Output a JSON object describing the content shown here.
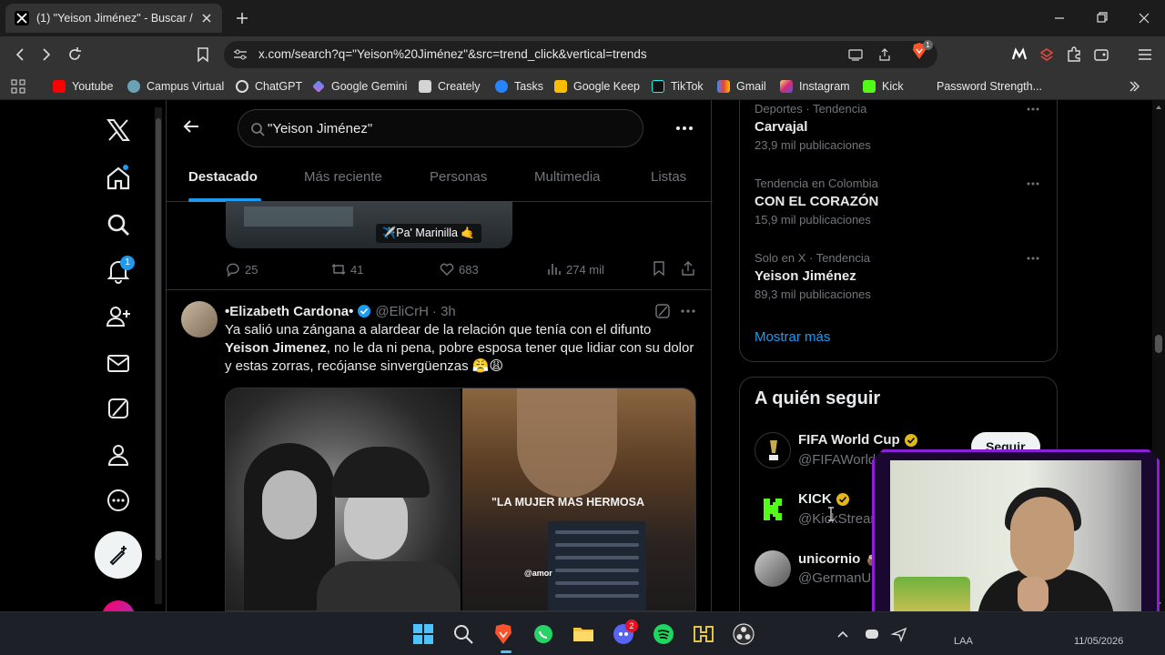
{
  "browser": {
    "tab_title": "(1) \"Yeison Jiménez\" - Buscar / X",
    "url": "x.com/search?q=\"Yeison%20Jiménez\"&src=trend_click&vertical=trends",
    "shield_count": "1",
    "bookmarks": [
      "Youtube",
      "Campus Virtual",
      "ChatGPT",
      "Google Gemini",
      "Creately",
      "Tasks",
      "Google Keep",
      "TikTok",
      "Gmail",
      "Instagram",
      "Kick",
      "Password Strength..."
    ]
  },
  "sidebar": {
    "notif_count": "1",
    "icons": [
      "x-logo-icon",
      "home-icon",
      "explore-icon",
      "notifications-icon",
      "follow-icon",
      "messages-icon",
      "grok-icon",
      "profile-icon",
      "more-icon",
      "post-icon"
    ]
  },
  "search": {
    "query": "\"Yeison Jiménez\""
  },
  "tabs": [
    "Destacado",
    "Más reciente",
    "Personas",
    "Multimedia",
    "Listas"
  ],
  "prev_tweet": {
    "media_label": "✈️Pa' Marinilla 🤙",
    "replies": "25",
    "reposts": "41",
    "likes": "683",
    "views": "274 mil"
  },
  "tweet": {
    "name": "•Elizabeth Cardona•",
    "handle": "@EliCrH",
    "time": "· 3h",
    "text_1": "Ya salió una zángana a alardear de la relación que tenía con el difunto ",
    "text_bold": "Yeison Jimenez",
    "text_2": ", no le da ni pena, pobre esposa tener que lidiar con su dolor y estas zorras, recójanse sinvergüenzas 😤😩",
    "media_caption": "\"LA MUJER MAS HERMOSA",
    "media_small": "@amor"
  },
  "trends": [
    {
      "meta": "Deportes · Tendencia",
      "name": "Carvajal",
      "count": "23,9 mil publicaciones"
    },
    {
      "meta": "Tendencia en Colombia",
      "name": "CON EL CORAZÓN",
      "count": "15,9 mil publicaciones"
    },
    {
      "meta": "Solo en X · Tendencia",
      "name": "Yeison Jiménez",
      "count": "89,3 mil publicaciones"
    }
  ],
  "show_more": "Mostrar más",
  "who_to_follow": {
    "title": "A quién seguir",
    "follow_label": "Seguir",
    "accounts": [
      {
        "name": "FIFA World Cup",
        "handle": "@FIFAWorld"
      },
      {
        "name": "KICK",
        "handle": "@KickStream"
      },
      {
        "name": "unicornio 🧉",
        "handle": "@GermanUs"
      }
    ]
  },
  "taskbar": {
    "discord_badge": "2",
    "tray_lang": "LAA",
    "tray_date": "11/05/2026"
  },
  "colors": {
    "accent": "#1d9bf0",
    "background": "#000000",
    "muted": "#71767b",
    "cam_frame": "#8b1fd6"
  }
}
